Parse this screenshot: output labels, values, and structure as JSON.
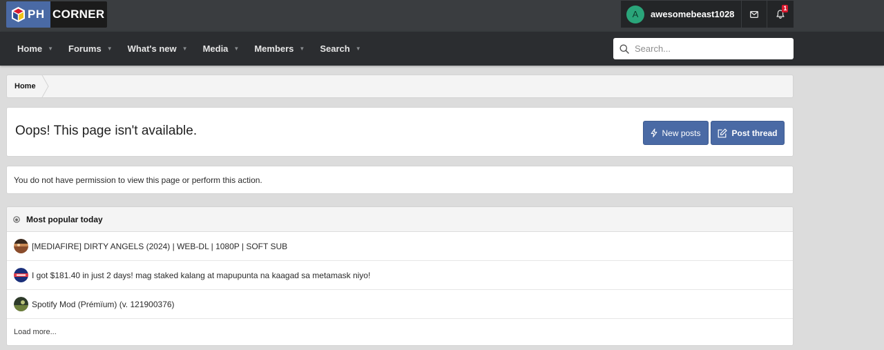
{
  "brand": {
    "logo_prefix": "PH",
    "logo_suffix": "CORNER",
    "primary_color": "#4a6aa5",
    "header_bg": "#3a3d40",
    "nav_bg": "#2b2d30"
  },
  "user": {
    "avatar_initial": "A",
    "username": "awesomebeast1028",
    "notification_count": "1"
  },
  "nav": {
    "items": [
      {
        "label": "Home"
      },
      {
        "label": "Forums"
      },
      {
        "label": "What's new"
      },
      {
        "label": "Media"
      },
      {
        "label": "Members"
      },
      {
        "label": "Search"
      }
    ]
  },
  "search": {
    "placeholder": "Search..."
  },
  "breadcrumb": {
    "home": "Home"
  },
  "page": {
    "title": "Oops! This page isn't available.",
    "new_posts_label": "New posts",
    "post_thread_label": "Post thread",
    "error_message": "You do not have permission to view this page or perform this action."
  },
  "popular": {
    "heading": "Most popular today",
    "items": [
      {
        "title": "[MEDIAFIRE] DIRTY ANGELS (2024) | WEB-DL | 1080P | SOFT SUB"
      },
      {
        "title": "I got $181.40 in just 2 days! mag staked kalang at mapupunta na kaagad sa metamask niyo!"
      },
      {
        "title": "Spotify Mod (Prémïum) (v. 121900376)"
      }
    ],
    "load_more": "Load more..."
  }
}
